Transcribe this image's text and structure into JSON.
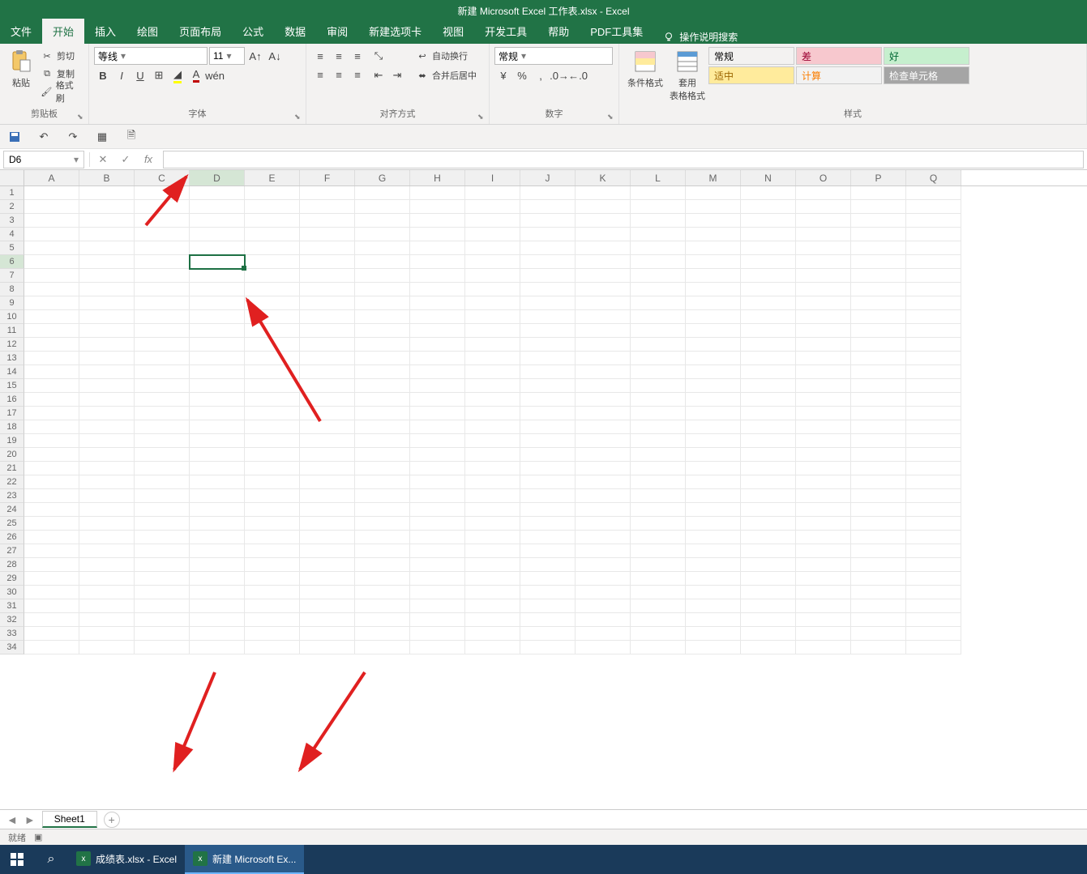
{
  "title": "新建 Microsoft Excel 工作表.xlsx - Excel",
  "tabs": [
    "文件",
    "开始",
    "插入",
    "绘图",
    "页面布局",
    "公式",
    "数据",
    "审阅",
    "新建选项卡",
    "视图",
    "开发工具",
    "帮助",
    "PDF工具集"
  ],
  "active_tab_index": 1,
  "tellme": "操作说明搜索",
  "clipboard": {
    "paste": "粘贴",
    "cut": "剪切",
    "copy": "复制",
    "format_painter": "格式刷",
    "label": "剪贴板"
  },
  "font": {
    "name": "等线",
    "size": "11",
    "bold": "B",
    "italic": "I",
    "underline": "U",
    "label": "字体"
  },
  "alignment": {
    "wrap": "自动换行",
    "merge": "合并后居中",
    "label": "对齐方式"
  },
  "number": {
    "format": "常规",
    "label": "数字"
  },
  "styles": {
    "cond": "条件格式",
    "table": "套用\n表格格式",
    "normal": "常规",
    "bad": "差",
    "good": "好",
    "neutral": "适中",
    "calc": "计算",
    "check": "检查单元格",
    "label": "样式"
  },
  "name_box": "D6",
  "formula": "",
  "columns": [
    "A",
    "B",
    "C",
    "D",
    "E",
    "F",
    "G",
    "H",
    "I",
    "J",
    "K",
    "L",
    "M",
    "N",
    "O",
    "P",
    "Q"
  ],
  "row_count": 34,
  "active_cell": {
    "col": 3,
    "row": 5
  },
  "sheet_tab": "Sheet1",
  "status": "就绪",
  "taskbar": {
    "app1": "成绩表.xlsx - Excel",
    "app2": "新建 Microsoft Ex..."
  },
  "style_colors": {
    "normal_bg": "#ffffff",
    "bad_bg": "#f7c8ce",
    "bad_fg": "#9c0031",
    "good_bg": "#c6efce",
    "good_fg": "#006833",
    "neutral_bg": "#ffeb9c",
    "neutral_fg": "#9c6500",
    "calc_bg": "#f2f2f2",
    "calc_fg": "#fa7d00",
    "check_bg": "#a5a5a5",
    "check_fg": "#ffffff"
  }
}
